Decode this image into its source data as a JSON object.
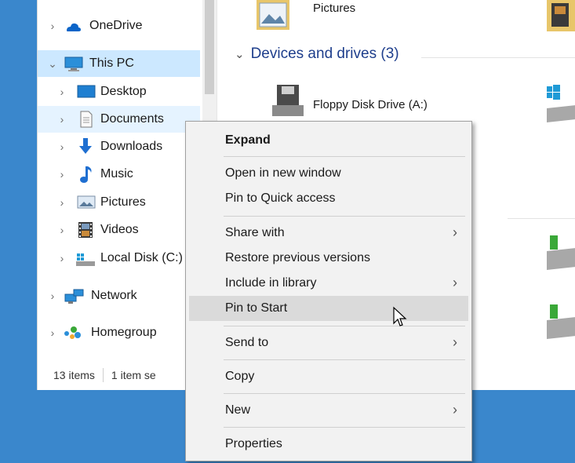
{
  "nav": {
    "items": [
      {
        "label": "OneDrive",
        "icon": "cloud-icon"
      },
      {
        "label": "This PC",
        "icon": "computer-icon"
      },
      {
        "label": "Desktop",
        "icon": "desktop-icon"
      },
      {
        "label": "Documents",
        "icon": "document-icon"
      },
      {
        "label": "Downloads",
        "icon": "download-arrow-icon"
      },
      {
        "label": "Music",
        "icon": "music-note-icon"
      },
      {
        "label": "Pictures",
        "icon": "pictures-icon"
      },
      {
        "label": "Videos",
        "icon": "film-icon"
      },
      {
        "label": "Local Disk (C:)",
        "icon": "disk-icon"
      },
      {
        "label": "Network",
        "icon": "network-icon"
      },
      {
        "label": "Homegroup",
        "icon": "homegroup-icon"
      }
    ]
  },
  "status": {
    "item_count": "13 items",
    "selection": "1 item se"
  },
  "content": {
    "top_folder_label": "Pictures",
    "group_header": "Devices and drives (3)",
    "floppy_label": "Floppy Disk Drive (A:)"
  },
  "context_menu": {
    "expand": "Expand",
    "open_new_window": "Open in new window",
    "pin_quick_access": "Pin to Quick access",
    "share_with": "Share with",
    "restore_versions": "Restore previous versions",
    "include_library": "Include in library",
    "pin_start": "Pin to Start",
    "send_to": "Send to",
    "copy": "Copy",
    "new": "New",
    "properties": "Properties"
  },
  "colors": {
    "desktop": "#3a87cc",
    "selected_row": "#cce8ff",
    "menu_bg": "#f2f2f2",
    "menu_highlight": "#dadada",
    "group_header_text": "#1e3e8c"
  }
}
